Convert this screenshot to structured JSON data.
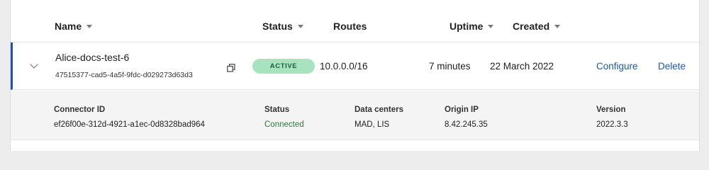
{
  "table": {
    "headers": {
      "name": "Name",
      "status": "Status",
      "routes": "Routes",
      "uptime": "Uptime",
      "created": "Created"
    },
    "rows": [
      {
        "name": "Alice-docs-test-6",
        "id": "47515377-cad5-4a5f-9fdc-d029273d63d3",
        "status": "ACTIVE",
        "routes": "10.0.0.0/16",
        "uptime": "7 minutes",
        "created": "22 March 2022",
        "actions": {
          "configure": "Configure",
          "delete": "Delete"
        }
      }
    ]
  },
  "connector": {
    "labels": {
      "connector_id": "Connector ID",
      "status": "Status",
      "data_centers": "Data centers",
      "origin_ip": "Origin IP",
      "version": "Version"
    },
    "values": {
      "connector_id": "ef26f00e-312d-4921-a1ec-0d8328bad964",
      "status": "Connected",
      "data_centers": "MAD, LIS",
      "origin_ip": "8.42.245.35",
      "version": "2022.3.3"
    }
  },
  "colors": {
    "accent_link": "#1c57b5",
    "row_indicator": "#1f4fb8",
    "active_badge_bg": "#a8e3c0",
    "active_badge_text": "#1b5e37",
    "connected_text": "#2a7a3e"
  },
  "icons": {
    "sort": "caret-down-icon",
    "expand": "chevron-down-icon",
    "copy": "copy-icon"
  }
}
